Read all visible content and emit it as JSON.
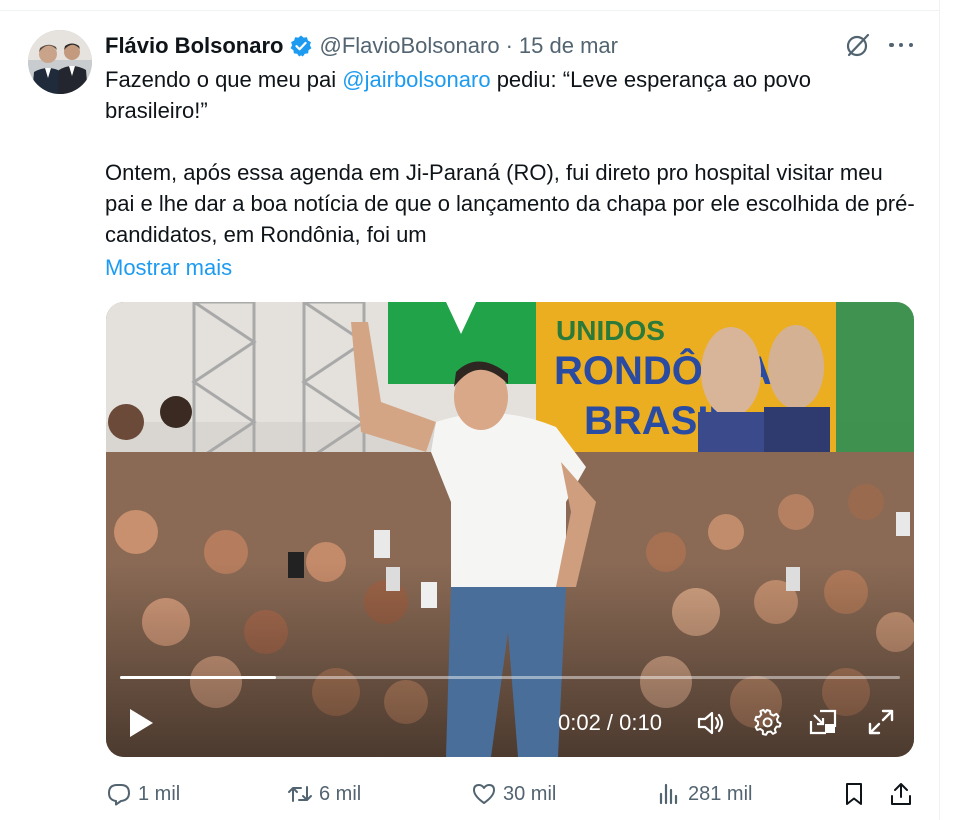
{
  "tweet": {
    "author": {
      "name": "Flávio Bolsonaro",
      "handle": "@FlavioBolsonaro",
      "separator": "·",
      "date": "15 de mar"
    },
    "text": {
      "line1_prefix": "Fazendo o que meu pai ",
      "mention": "@jairbolsonaro",
      "line1_suffix": " pediu: “Leve esperança ao povo brasileiro!”",
      "paragraph2": "Ontem, após essa agenda em Ji-Paraná (RO), fui direto pro hospital visitar meu pai e lhe dar a  boa notícia de que o lançamento da chapa por ele escolhida de pré-candidatos, em Rondônia, foi um"
    },
    "show_more": "Mostrar mais",
    "video": {
      "current_time": "0:02",
      "duration": "0:10",
      "time_label": "0:02 / 0:10",
      "progress_fraction": 0.2,
      "banner_text": "UNIDOS RONDÔNIA BRASIL"
    },
    "actions": {
      "replies": "1 mil",
      "reposts": "6 mil",
      "likes": "30 mil",
      "views": "281 mil"
    },
    "icons": {
      "verified": "verified-badge-icon",
      "grok": "grok-icon",
      "more": "more-icon",
      "reply": "reply-icon",
      "repost": "repost-icon",
      "like": "heart-icon",
      "views": "views-icon",
      "bookmark": "bookmark-icon",
      "share": "share-icon"
    },
    "colors": {
      "accent": "#1d9bf0",
      "text_primary": "#0f1419",
      "text_secondary": "#536471"
    }
  }
}
